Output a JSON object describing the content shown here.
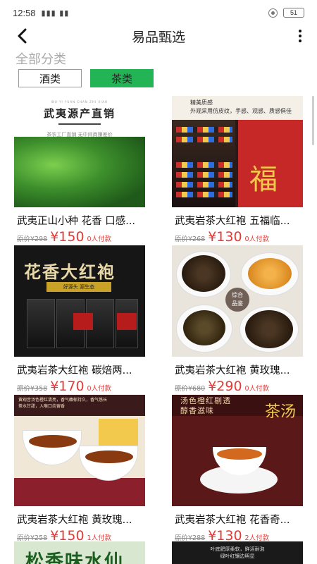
{
  "status_bar": {
    "time": "12:58",
    "signal": "▮▮▮ ▮▮",
    "battery": "51"
  },
  "header": {
    "title": "易品甄选"
  },
  "section_label": "全部分类",
  "tabs": [
    {
      "label": "酒类",
      "active": false
    },
    {
      "label": "茶类",
      "active": true
    }
  ],
  "products": [
    {
      "name": "武夷正山小种 花香 口感...",
      "original_price": "原价¥298",
      "price": "¥150",
      "sold": "0人付款",
      "thumb": {
        "en": "WU YI YUAN CHAN ZHI XIAO",
        "title": "武夷源产直销",
        "sub": "茶农工厂直销 无中间商赚差价"
      }
    },
    {
      "name": "武夷岩茶大红袍 五福临...",
      "original_price": "原价¥268",
      "price": "¥130",
      "sold": "0人付款",
      "thumb": {
        "banner": "精美质感\n外观采用仿皮纹，手感、观感、质感俱佳",
        "fu": "福"
      }
    },
    {
      "name": "武夷岩茶大红袍 碳焙两...",
      "original_price": "原价¥358",
      "price": "¥170",
      "sold": "0人付款",
      "thumb": {
        "title": "花香大红袍",
        "tag": "好源头 源生态"
      }
    },
    {
      "name": "武夷岩茶大红袍 黄玫瑰...",
      "original_price": "原价¥680",
      "price": "¥290",
      "sold": "0人付款",
      "thumb": {
        "badge": "综合\n品鉴"
      }
    },
    {
      "name": "武夷岩茶大红袍 黄玫瑰...",
      "original_price": "原价¥258",
      "price": "¥150",
      "sold": "1人付款",
      "thumb": {
        "band": "黄观音汤色橙红清亮，香气馥郁持久，香气悠长\n茶水甘甜，入喉口齿留香"
      }
    },
    {
      "name": "武夷岩茶大红袍 花香奇...",
      "original_price": "原价¥288",
      "price": "¥130",
      "sold": "2人付款",
      "thumb": {
        "band": "汤色橙红剔透\n醇香滋味",
        "cha": "茶汤"
      }
    }
  ],
  "partial_cards": [
    {
      "text": "松香味水仙"
    },
    {
      "text": "叶底肥厚柔软，鲜活耐泡\n绿叶红镶边明显"
    }
  ],
  "colors": {
    "accent": "#22b455",
    "price": "#e53935"
  }
}
